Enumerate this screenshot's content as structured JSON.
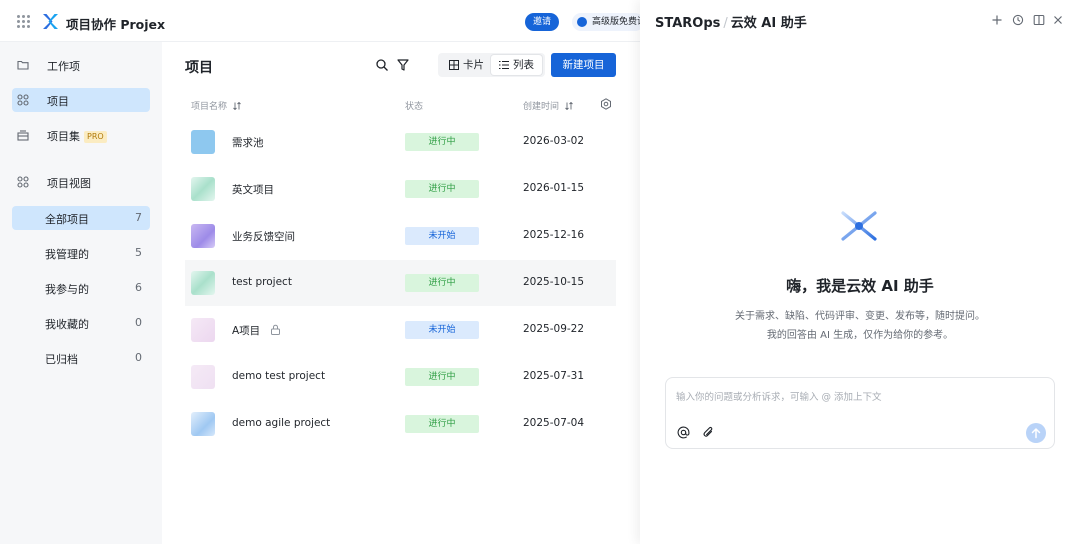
{
  "app": {
    "title": "项目协作 Projex"
  },
  "topbar": {
    "invite_label": "邀请",
    "trial_label": "高级版免费试用"
  },
  "sidebar": {
    "items": [
      {
        "label": "工作项",
        "icon": "folder-icon"
      },
      {
        "label": "项目",
        "icon": "apps-icon",
        "active": true
      },
      {
        "label": "项目集",
        "icon": "stack-icon",
        "tag": "PRO"
      },
      {
        "label": "项目视图",
        "icon": "apps-icon"
      }
    ],
    "views": [
      {
        "label": "全部项目",
        "count": "7",
        "active": true
      },
      {
        "label": "我管理的",
        "count": "5"
      },
      {
        "label": "我参与的",
        "count": "6"
      },
      {
        "label": "我收藏的",
        "count": "0"
      },
      {
        "label": "已归档",
        "count": "0"
      }
    ]
  },
  "main": {
    "title": "项目",
    "view_card_label": "卡片",
    "view_list_label": "列表",
    "new_button_label": "新建项目",
    "columns": {
      "name": "项目名称",
      "status": "状态",
      "created": "创建时间"
    },
    "rows": [
      {
        "name": "需求池",
        "status": "进行中",
        "date": "2026-03-02"
      },
      {
        "name": "英文项目",
        "status": "进行中",
        "date": "2026-01-15"
      },
      {
        "name": "业务反馈空间",
        "status": "未开始",
        "date": "2025-12-16"
      },
      {
        "name": "test project",
        "status": "进行中",
        "date": "2025-10-15"
      },
      {
        "name": "A项目",
        "status": "未开始",
        "date": "2025-09-22"
      },
      {
        "name": "demo test project",
        "status": "进行中",
        "date": "2025-07-31"
      },
      {
        "name": "demo agile project",
        "status": "进行中",
        "date": "2025-07-04"
      }
    ]
  },
  "assistant": {
    "brand": "STAROps",
    "separator": "/",
    "title": "云效 AI 助手",
    "greeting": "嗨，我是云效 AI 助手",
    "desc_line1": "关于需求、缺陷、代码评审、变更、发布等，随时提问。",
    "desc_line2": "我的回答由 AI 生成，仅作为给你的参考。",
    "input_placeholder": "输入你的问题或分析诉求，可输入 @ 添加上下文"
  },
  "colors": {
    "accent": "#1664d8",
    "in_progress_bg": "#d9f5dd",
    "in_progress_fg": "#2f9e44",
    "todo_bg": "#dbeafd",
    "todo_fg": "#1664d8"
  }
}
